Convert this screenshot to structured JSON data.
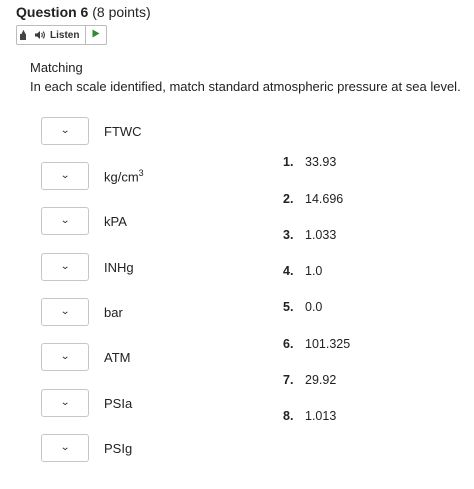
{
  "question": {
    "label": "Question 6",
    "points": "(8 points)"
  },
  "listen": {
    "label": "Listen"
  },
  "section_title": "Matching",
  "instructions": "In each scale identified, match standard atmospheric pressure at sea level.",
  "left_items": [
    {
      "label": "FTWC",
      "selected": ""
    },
    {
      "label": "kg/cm",
      "sup": "3",
      "selected": ""
    },
    {
      "label": "kPA",
      "selected": ""
    },
    {
      "label": "INHg",
      "selected": ""
    },
    {
      "label": "bar",
      "selected": ""
    },
    {
      "label": "ATM",
      "selected": ""
    },
    {
      "label": "PSIa",
      "selected": ""
    },
    {
      "label": "PSIg",
      "selected": ""
    }
  ],
  "right_items": [
    {
      "num": "1.",
      "value": "33.93"
    },
    {
      "num": "2.",
      "value": "14.696"
    },
    {
      "num": "3.",
      "value": "1.033"
    },
    {
      "num": "4.",
      "value": "1.0"
    },
    {
      "num": "5.",
      "value": "0.0"
    },
    {
      "num": "6.",
      "value": "101.325"
    },
    {
      "num": "7.",
      "value": "29.92"
    },
    {
      "num": "8.",
      "value": "1.013"
    }
  ],
  "icons": {
    "toolbar": "toolbar-toggle-icon",
    "speaker": "speaker-icon",
    "play": "play-icon",
    "dropdown": "chevron-down-icon"
  },
  "colors": {
    "play": "#2e8b2e",
    "speaker": "#3a3a3a",
    "border": "#c6c6c6"
  }
}
